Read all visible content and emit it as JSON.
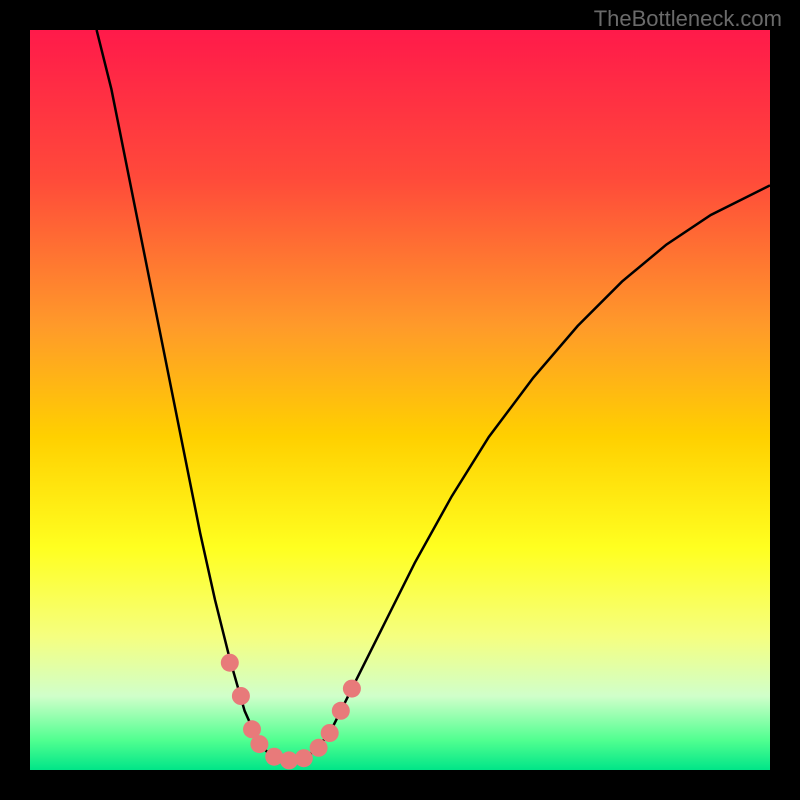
{
  "watermark": "TheBottleneck.com",
  "chart_data": {
    "type": "line",
    "title": "",
    "xlabel": "",
    "ylabel": "",
    "xlim": [
      0,
      100
    ],
    "ylim": [
      0,
      100
    ],
    "gradient_stops": [
      {
        "offset": 0.0,
        "color": "#ff1a4a"
      },
      {
        "offset": 0.2,
        "color": "#ff4a3a"
      },
      {
        "offset": 0.4,
        "color": "#ff9a2a"
      },
      {
        "offset": 0.55,
        "color": "#ffd000"
      },
      {
        "offset": 0.7,
        "color": "#ffff20"
      },
      {
        "offset": 0.82,
        "color": "#f5ff80"
      },
      {
        "offset": 0.9,
        "color": "#d0ffca"
      },
      {
        "offset": 0.96,
        "color": "#50ff90"
      },
      {
        "offset": 1.0,
        "color": "#00e588"
      }
    ],
    "series": [
      {
        "name": "curve",
        "type": "path",
        "stroke": "#000000",
        "points": [
          {
            "x": 9.0,
            "y": 100.0
          },
          {
            "x": 11.0,
            "y": 92.0
          },
          {
            "x": 13.0,
            "y": 82.0
          },
          {
            "x": 15.0,
            "y": 72.0
          },
          {
            "x": 17.0,
            "y": 62.0
          },
          {
            "x": 19.0,
            "y": 52.0
          },
          {
            "x": 21.0,
            "y": 42.0
          },
          {
            "x": 23.0,
            "y": 32.0
          },
          {
            "x": 25.0,
            "y": 23.0
          },
          {
            "x": 27.0,
            "y": 15.0
          },
          {
            "x": 29.0,
            "y": 8.0
          },
          {
            "x": 31.0,
            "y": 3.5
          },
          {
            "x": 33.0,
            "y": 1.5
          },
          {
            "x": 35.0,
            "y": 1.2
          },
          {
            "x": 37.0,
            "y": 1.5
          },
          {
            "x": 39.0,
            "y": 3.0
          },
          {
            "x": 41.0,
            "y": 6.0
          },
          {
            "x": 44.0,
            "y": 12.0
          },
          {
            "x": 48.0,
            "y": 20.0
          },
          {
            "x": 52.0,
            "y": 28.0
          },
          {
            "x": 57.0,
            "y": 37.0
          },
          {
            "x": 62.0,
            "y": 45.0
          },
          {
            "x": 68.0,
            "y": 53.0
          },
          {
            "x": 74.0,
            "y": 60.0
          },
          {
            "x": 80.0,
            "y": 66.0
          },
          {
            "x": 86.0,
            "y": 71.0
          },
          {
            "x": 92.0,
            "y": 75.0
          },
          {
            "x": 100.0,
            "y": 79.0
          }
        ]
      },
      {
        "name": "markers",
        "type": "scatter",
        "color": "#e87a7a",
        "points": [
          {
            "x": 27.0,
            "y": 14.5
          },
          {
            "x": 28.5,
            "y": 10.0
          },
          {
            "x": 30.0,
            "y": 5.5
          },
          {
            "x": 31.0,
            "y": 3.5
          },
          {
            "x": 33.0,
            "y": 1.8
          },
          {
            "x": 35.0,
            "y": 1.3
          },
          {
            "x": 37.0,
            "y": 1.6
          },
          {
            "x": 39.0,
            "y": 3.0
          },
          {
            "x": 40.5,
            "y": 5.0
          },
          {
            "x": 42.0,
            "y": 8.0
          },
          {
            "x": 43.5,
            "y": 11.0
          }
        ]
      }
    ]
  }
}
